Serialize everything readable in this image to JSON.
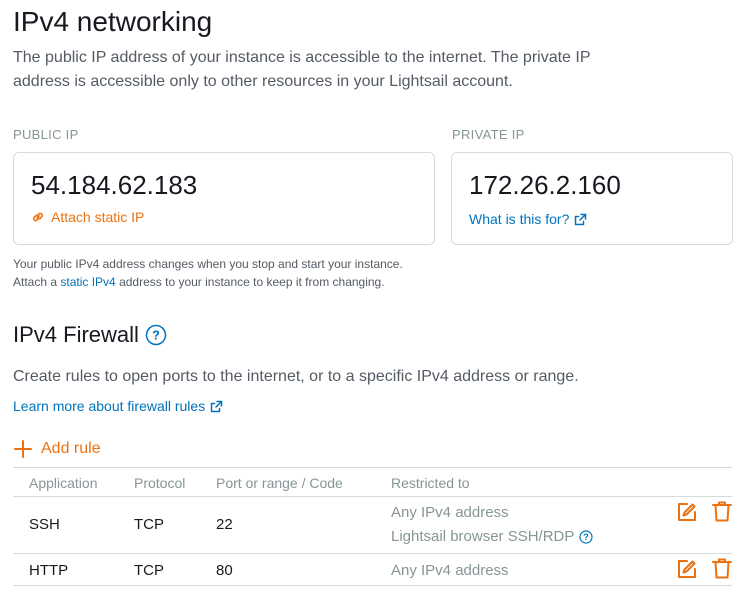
{
  "networking": {
    "title": "IPv4 networking",
    "description": "The public IP address of your instance is accessible to the internet. The private IP address is accessible only to other resources in your Lightsail account."
  },
  "public_ip": {
    "label": "PUBLIC IP",
    "address": "54.184.62.183",
    "action": "Attach static IP"
  },
  "private_ip": {
    "label": "PRIVATE IP",
    "address": "172.26.2.160",
    "help_link": "What is this for?"
  },
  "ip_note": {
    "line1": "Your public IPv4 address changes when you stop and start your instance.",
    "line2_prefix": "Attach a",
    "line2_link": "static IPv4",
    "line2_suffix": "address to your instance to keep it from changing."
  },
  "firewall": {
    "title": "IPv4 Firewall",
    "description": "Create rules to open ports to the internet, or to a specific IPv4 address or range.",
    "learn_more": "Learn more about firewall rules",
    "add_rule": "Add rule",
    "columns": [
      "Application",
      "Protocol",
      "Port or range / Code",
      "Restricted to"
    ],
    "rules": [
      {
        "application": "SSH",
        "protocol": "TCP",
        "port": "22",
        "restricted": "Any IPv4 address",
        "restricted_extra": "Lightsail browser SSH/RDP"
      },
      {
        "application": "HTTP",
        "protocol": "TCP",
        "port": "80",
        "restricted": "Any IPv4 address"
      }
    ]
  },
  "colors": {
    "accent": "#ec7211",
    "link": "#0073bb",
    "muted": "#879596",
    "border": "#d5dbdb"
  },
  "icons": {
    "attach": "link-icon",
    "external": "external-link-icon",
    "help": "help-circle-icon",
    "add": "plus-icon",
    "edit": "edit-icon",
    "delete": "trash-icon"
  }
}
